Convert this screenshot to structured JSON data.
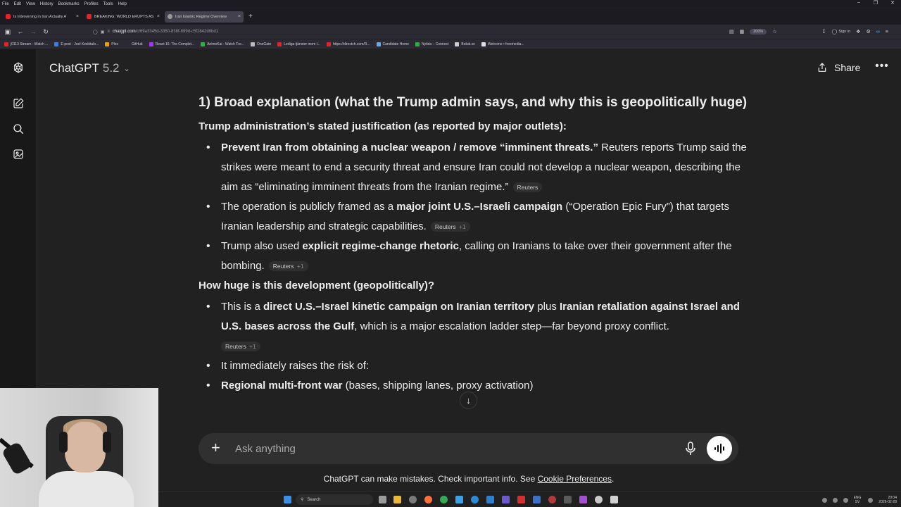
{
  "browser": {
    "menu": [
      "File",
      "Edit",
      "View",
      "History",
      "Bookmarks",
      "Profiles",
      "Tools",
      "Help"
    ],
    "tabs": [
      {
        "title": "Is Intervening in Iran Actually A",
        "color": "#e0242a",
        "active": false
      },
      {
        "title": "BREAKING: WORLD ERUPTS AS",
        "color": "#e0242a",
        "active": false
      },
      {
        "title": "Iran Islamic Regime Overview",
        "color": "#9a9a9a",
        "active": true
      }
    ],
    "url_host": "chatgpt.com",
    "url_path": "/c/69a3345d-3350-838f-899d-c5f2842d9bd1",
    "zoom": "200%",
    "signin_label": "Sign in",
    "bookmarks": [
      {
        "label": "j0113 Stream - Watch ...",
        "color": "#e0242a"
      },
      {
        "label": "E-post - Joel Keskitalo...",
        "color": "#3d7de0"
      },
      {
        "label": "Plex",
        "color": "#e5a00d"
      },
      {
        "label": "GitHub",
        "color": "#cccccc"
      },
      {
        "label": "React 16: The Complet...",
        "color": "#a435f0"
      },
      {
        "label": "AnimeKai - Watch Fre...",
        "color": "#2bb04a"
      },
      {
        "label": "OneGate",
        "color": "#bbbbbb"
      },
      {
        "label": "Lediga tjänster inom l...",
        "color": "#e0242a"
      },
      {
        "label": "https://directch.com/R...",
        "color": "#e0242a"
      },
      {
        "label": "Candidate Home",
        "color": "#6fa8dc"
      },
      {
        "label": "Nytida – Connect",
        "color": "#2bb04a"
      },
      {
        "label": "Bokat.se",
        "color": "#cccccc"
      },
      {
        "label": "Welcome • freemedia...",
        "color": "#e0e0e0"
      }
    ]
  },
  "header": {
    "title": "ChatGPT",
    "version": "5.2",
    "share_label": "Share"
  },
  "content": {
    "heading": "1) Broad explanation (what the Trump admin says, and why this is geopolitically huge)",
    "section1_title": "Trump administration’s stated justification (as reported by major outlets):",
    "b1_bold": "Prevent Iran from obtaining a nuclear weapon / remove “imminent threats.”",
    "b1_text": " Reuters reports Trump said the strikes were meant to end a security threat and ensure Iran could not develop a nuclear weapon, describing the aim as “eliminating imminent threats from the Iranian regime.”",
    "b1_cite": "Reuters",
    "b2_pre": "The operation is publicly framed as a ",
    "b2_bold": "major joint U.S.–Israeli campaign",
    "b2_post": " (“Operation Epic Fury”) that targets Iranian leadership and strategic capabilities.",
    "b2_cite": "Reuters",
    "b2_cite_plus": "+1",
    "b3_pre": "Trump also used ",
    "b3_bold": "explicit regime-change rhetoric",
    "b3_post": ", calling on Iranians to take over their government after the bombing.",
    "b3_cite": "Reuters",
    "b3_cite_plus": "+1",
    "section2_title": "How huge is this development (geopolitically)?",
    "b4_pre": "This is a ",
    "b4_bold1": "direct U.S.–Israel kinetic campaign on Iranian territory",
    "b4_mid": " plus ",
    "b4_bold2": "Iranian retaliation against Israel and U.S. bases across the Gulf",
    "b4_post": ", which is a major escalation ladder step—far beyond proxy conflict.",
    "b4_cite": "Reuters",
    "b4_cite_plus": "+1",
    "b5_text": "It immediately raises the risk of:",
    "sub1_bold": "Regional multi-front war",
    "sub1_text": " (bases, shipping lanes, proxy activation)"
  },
  "composer": {
    "placeholder": "Ask anything"
  },
  "footer": {
    "disclaimer_pre": "ChatGPT can make mistakes. Check important info. See ",
    "disclaimer_link": "Cookie Preferences",
    "disclaimer_post": "."
  },
  "taskbar": {
    "search_label": "Search",
    "lang_top": "ENG",
    "lang_bottom": "SV",
    "time": "20:04",
    "date": "2026-02-28"
  }
}
